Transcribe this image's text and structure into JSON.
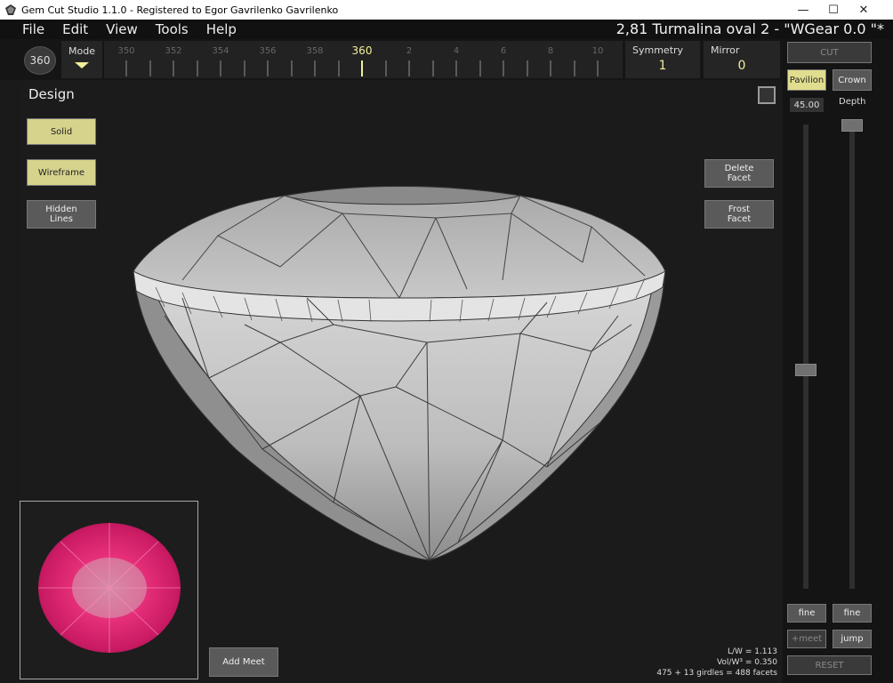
{
  "window": {
    "title": "Gem Cut Studio 1.1.0 - Registered to Egor Gavrilenko Gavrilenko",
    "minimize": "—",
    "maximize": "☐",
    "close": "✕"
  },
  "menu": {
    "items": [
      "File",
      "Edit",
      "View",
      "Tools",
      "Help"
    ]
  },
  "document_title": "2,81 Turmalina oval 2 - \"WGear 0.0 \"*",
  "toolbar": {
    "btn_360": "360",
    "mode_label": "Mode",
    "ruler_labels": [
      "350",
      "352",
      "354",
      "356",
      "358",
      "360",
      "2",
      "4",
      "6",
      "8",
      "10"
    ],
    "ruler_active": "360",
    "symmetry_label": "Symmetry",
    "symmetry_value": "1",
    "mirror_label": "Mirror",
    "mirror_value": "0"
  },
  "design": {
    "title": "Design",
    "solid": "Solid",
    "wireframe": "Wireframe",
    "hidden_lines": [
      "Hidden",
      "Lines"
    ],
    "delete_facet": [
      "Delete",
      "Facet"
    ],
    "frost_facet": [
      "Frost",
      "Facet"
    ],
    "add_meet": "Add Meet",
    "stats": [
      "L/W = 1.113",
      "Vol/W³ = 0.350",
      "475 + 13 girdles = 488 facets"
    ]
  },
  "panel": {
    "cut": "CUT",
    "pavilion": "Pavilion",
    "crown": "Crown",
    "angle_value": "45.00",
    "depth_label": "Depth",
    "fine_left": "fine",
    "fine_right": "fine",
    "meet": "+meet",
    "jump": "jump",
    "reset": "RESET",
    "angle_slider_fraction": 0.53,
    "depth_slider_fraction": 0.0
  },
  "colors": {
    "accent_yellow": "#f2ee9a",
    "button_yellow": "#d6d38d",
    "preview_gem": "#e8307a"
  },
  "icons": {
    "app": "gem-icon",
    "mode": "triangle-down-icon"
  }
}
